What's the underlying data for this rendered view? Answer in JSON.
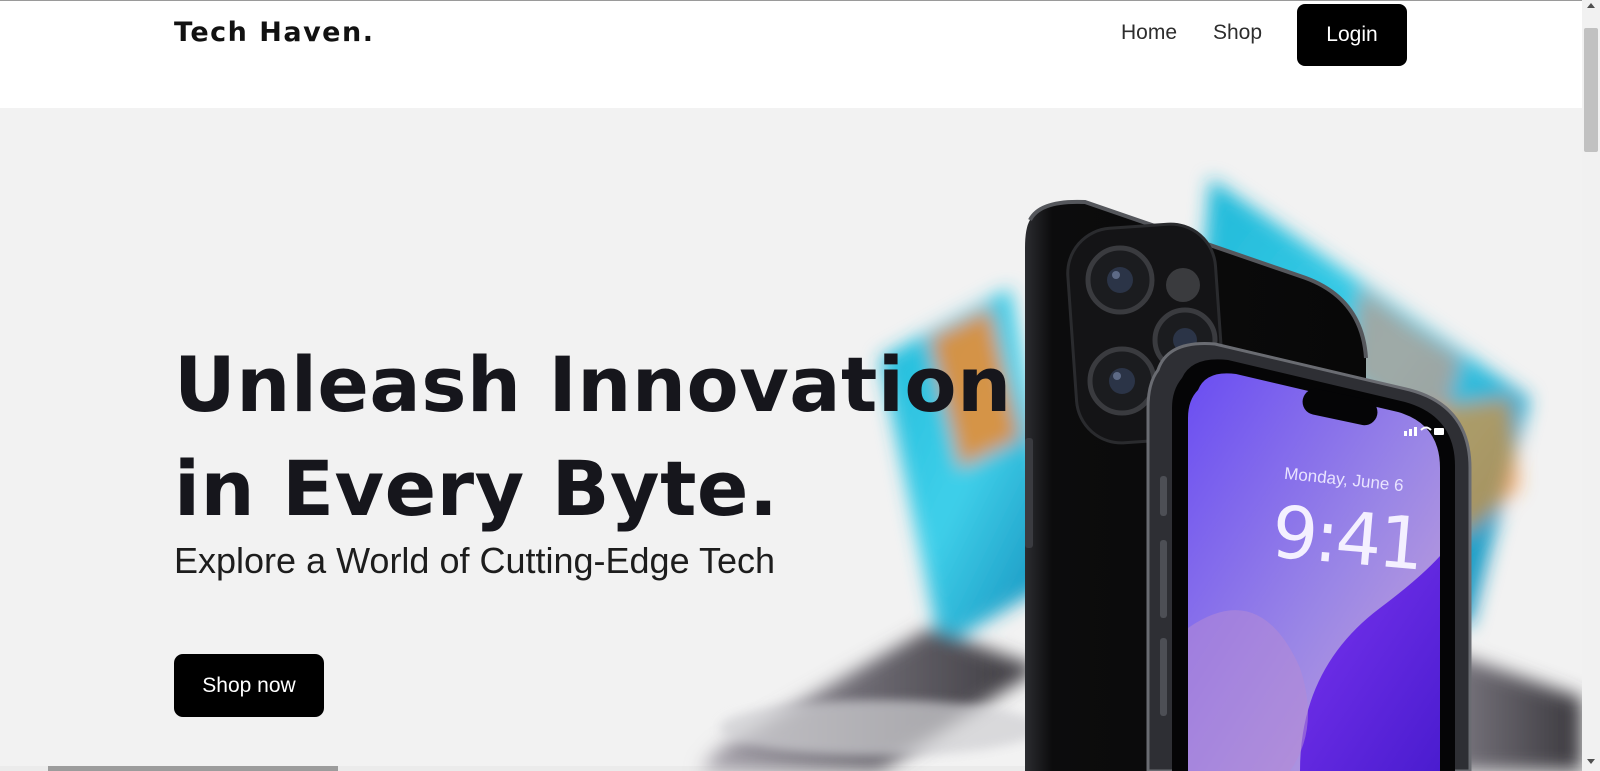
{
  "brand": {
    "logo": "Tech Haven."
  },
  "nav": {
    "links": [
      {
        "label": "Home"
      },
      {
        "label": "Shop"
      }
    ],
    "login_label": "Login"
  },
  "hero": {
    "title_line1": "Unleash Innovation",
    "title_line2": "in Every Byte.",
    "subtitle": "Explore a World of Cutting-Edge Tech",
    "cta_label": "Shop now",
    "phone_screen": {
      "date": "Monday, June 6",
      "time": "9:41"
    }
  },
  "colors": {
    "button_bg": "#000000",
    "hero_bg": "#f2f2f2",
    "headline": "#16161c",
    "phone_screen": "#7a4ff0"
  },
  "icons": [
    "scroll-up-arrow-icon",
    "scroll-down-arrow-icon",
    "signal-icon",
    "wifi-icon",
    "battery-icon"
  ]
}
